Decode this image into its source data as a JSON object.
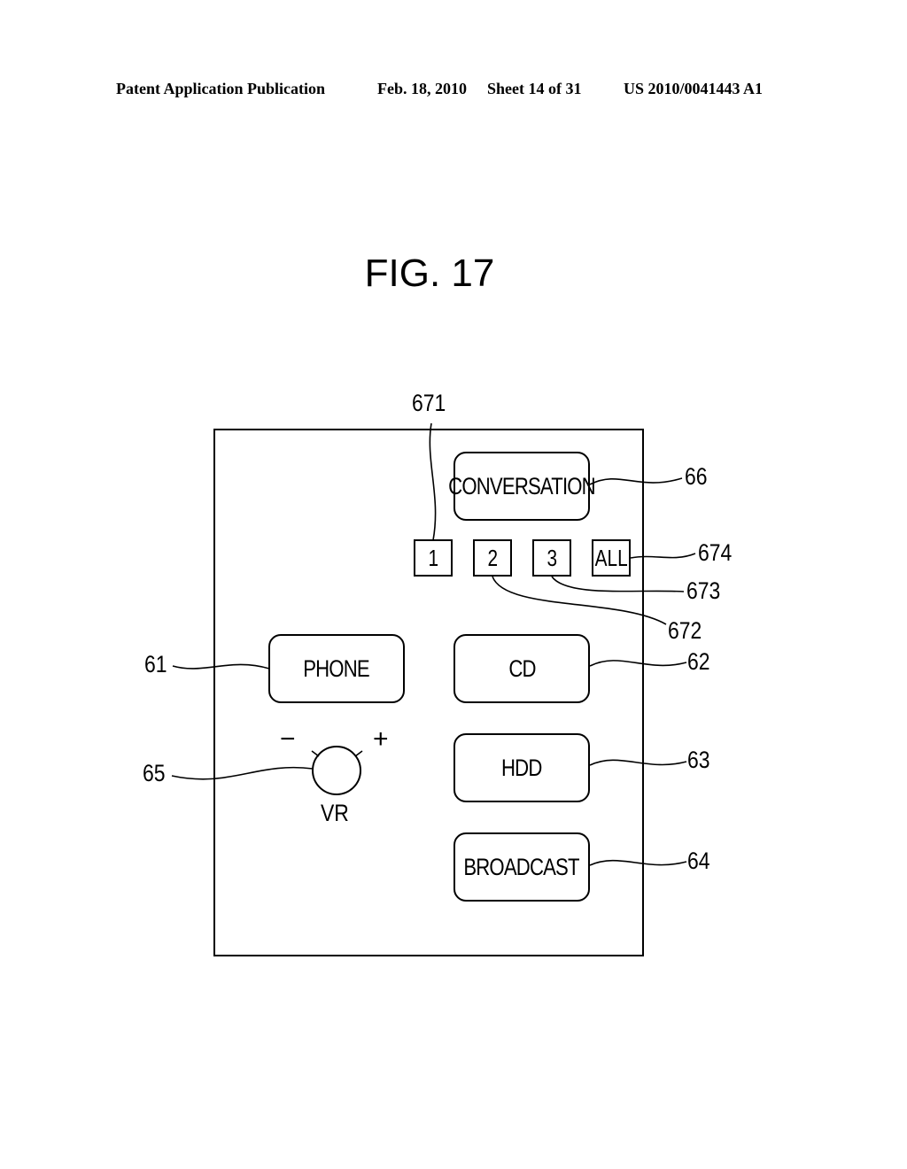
{
  "header": {
    "publication": "Patent Application Publication",
    "date": "Feb. 18, 2010",
    "sheet": "Sheet 14 of 31",
    "number": "US 2010/0041443 A1"
  },
  "figure": {
    "title": "FIG. 17"
  },
  "panel": {
    "buttons": {
      "conversation": "CONVERSATION",
      "phone": "PHONE",
      "cd": "CD",
      "hdd": "HDD",
      "broadcast": "BROADCAST"
    },
    "selectors": [
      "1",
      "2",
      "3",
      "ALL"
    ],
    "volume": {
      "label": "VR",
      "minus": "−",
      "plus": "+"
    }
  },
  "reference_numerals": {
    "conversation": "66",
    "selector_1": "671",
    "selector_2": "672",
    "selector_3": "673",
    "selector_all": "674",
    "phone": "61",
    "cd": "62",
    "hdd": "63",
    "broadcast": "64",
    "volume": "65"
  }
}
